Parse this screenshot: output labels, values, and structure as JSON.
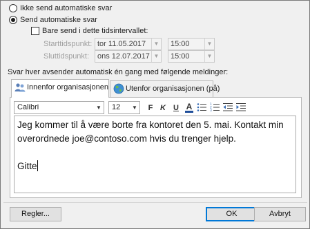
{
  "options": {
    "no_auto_reply": "Ikke send automatiske svar",
    "send_auto_reply": "Send automatiske svar",
    "only_time_range": "Bare send i dette tidsintervallet:"
  },
  "time": {
    "start_label": "Starttidspunkt:",
    "start_date": "tor 11.05.2017",
    "start_time": "15:00",
    "end_label": "Sluttidspunkt:",
    "end_date": "ons 12.07.2017",
    "end_time": "15:00"
  },
  "instruction": "Svar hver avsender automatisk én gang med følgende meldinger:",
  "tabs": [
    {
      "label": "Innenfor organisasjonen",
      "icon": "people-icon"
    },
    {
      "label": "Utenfor organisasjonen (på)",
      "icon": "globe-icon"
    }
  ],
  "toolbar": {
    "font": "Calibri",
    "size": "12",
    "bold": "F",
    "italic": "K",
    "underline": "U",
    "font_color": "A",
    "font_color_hex": "#1f4e9a"
  },
  "message": {
    "line1": "Jeg kommer til å være borte fra kontoret den 5. mai. Kontakt min",
    "line2": "overordnede joe@contoso.com hvis du trenger hjelp.",
    "signature": "Gitte"
  },
  "buttons": {
    "rules": "Regler...",
    "ok": "OK",
    "cancel": "Avbryt"
  }
}
